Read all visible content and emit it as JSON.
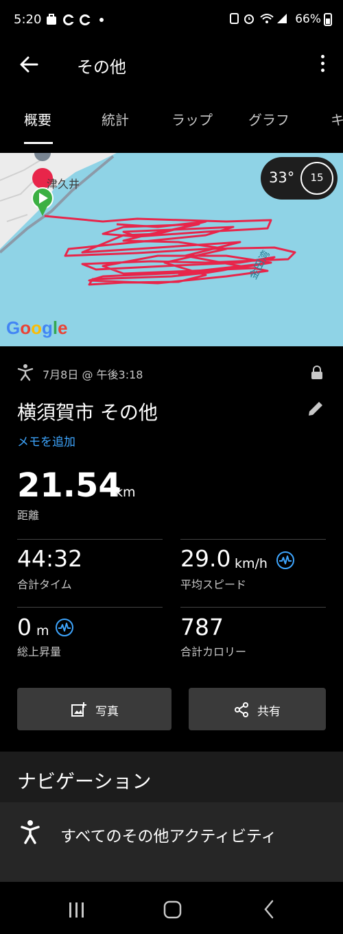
{
  "status_bar": {
    "time": "5:20",
    "left_icons": [
      "bag-icon",
      "c-icon",
      "c-icon",
      "dot-icon"
    ],
    "battery": "66%"
  },
  "app_bar": {
    "title": "その他"
  },
  "tabs": [
    {
      "label": "概要",
      "active": true
    },
    {
      "label": "統計",
      "active": false
    },
    {
      "label": "ラップ",
      "active": false
    },
    {
      "label": "グラフ",
      "active": false
    },
    {
      "label": "キ",
      "active": false
    }
  ],
  "map": {
    "place_label": "津久井",
    "bay_label": "金田湾",
    "weather_temp": "33°",
    "dial_value": "15",
    "attribution": "Google",
    "colors": {
      "water": "#8fd3e6",
      "track": "#e8254a",
      "start": "#3cb043"
    }
  },
  "activity": {
    "date": "7月8日 @ 午後3:18",
    "title": "横須賀市 その他",
    "memo_link": "メモを追加",
    "distance": {
      "value": "21.54",
      "unit": "km",
      "label": "距離"
    },
    "stats": [
      {
        "value": "44:32",
        "unit": "",
        "label": "合計タイム"
      },
      {
        "value": "29.0",
        "unit": "km/h",
        "label": "平均スピード"
      },
      {
        "value": "0",
        "unit": "m",
        "label": "総上昇量"
      },
      {
        "value": "787",
        "unit": "",
        "label": "合計カロリー"
      }
    ]
  },
  "buttons": {
    "photo": "写真",
    "share": "共有"
  },
  "navigation": {
    "heading": "ナビゲーション",
    "item": "すべてのその他アクティビティ"
  },
  "accent_color": "#3ea6ff"
}
